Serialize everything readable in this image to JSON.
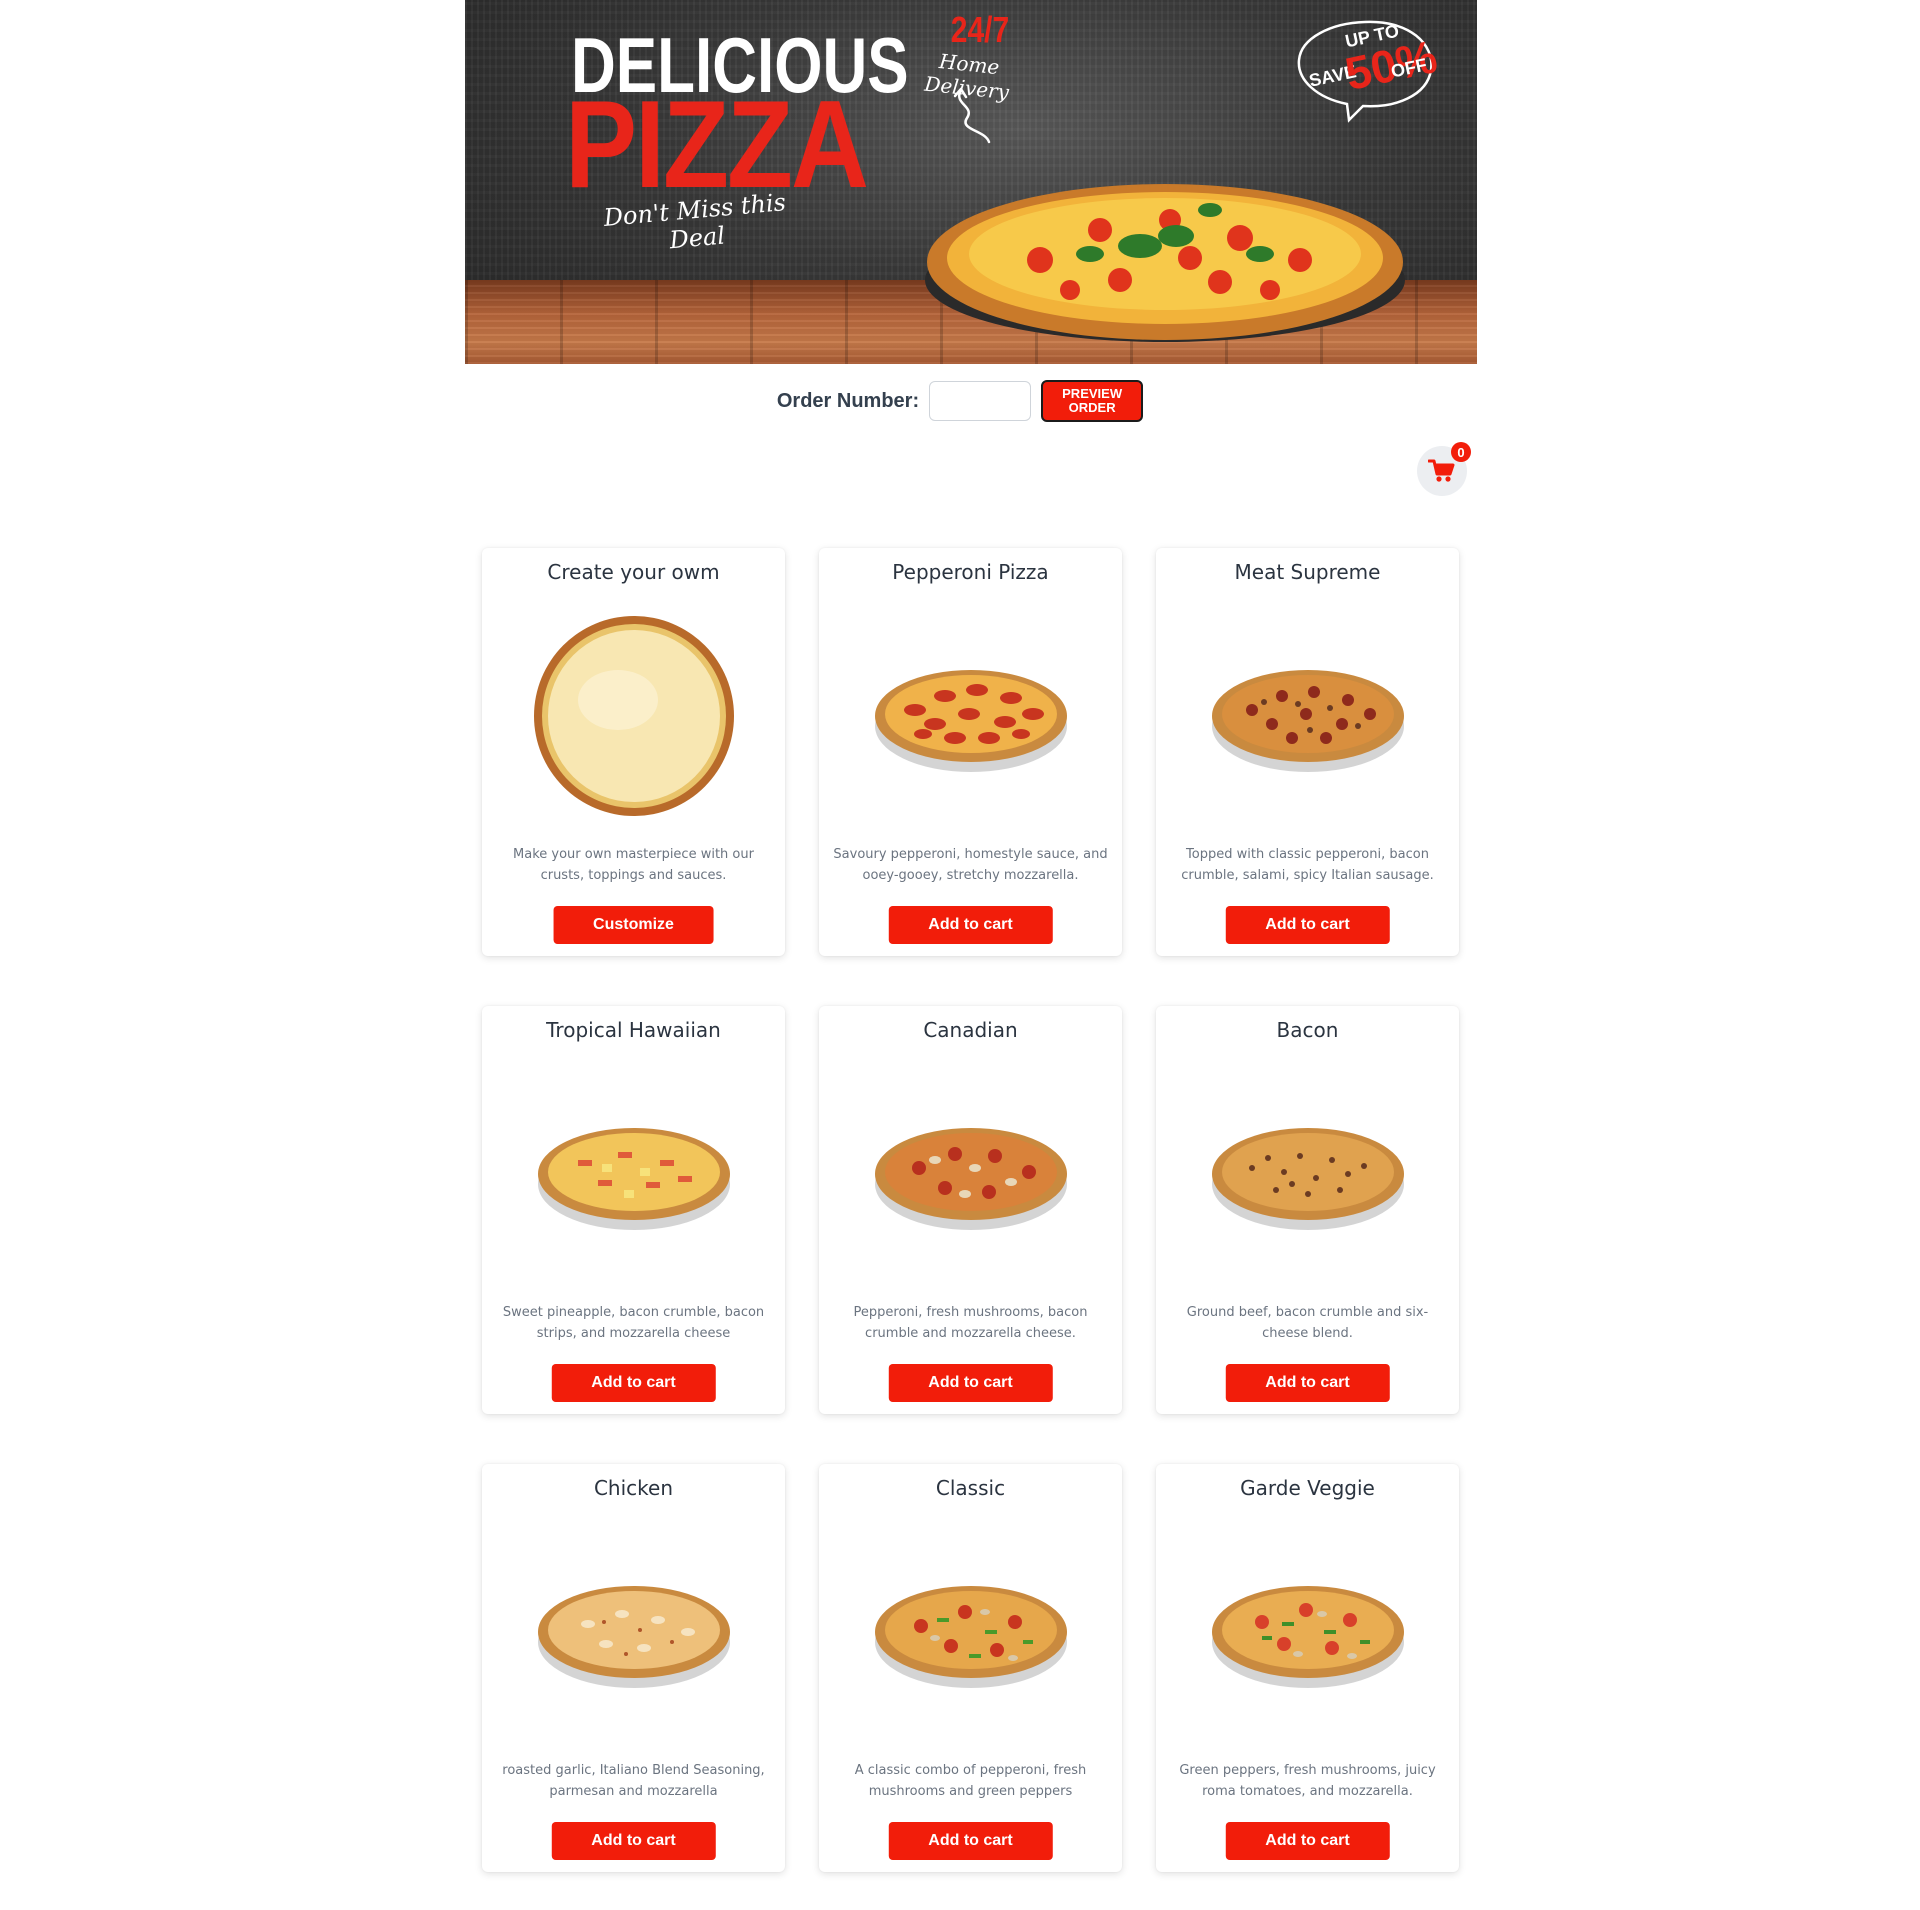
{
  "banner": {
    "headline_top": "DELICIOUS",
    "headline_main": "PIZZA",
    "tagline": "Don't Miss this Deal",
    "delivery_hours": "24/7",
    "delivery_label": "Home Delivery",
    "promo_up_to": "UP TO",
    "promo_save": "SAVE",
    "promo_percent": "50%",
    "promo_off": "OFF",
    "colors": {
      "accent_red": "#e8251a",
      "wall": "#3a3a3a",
      "wood": "#b5643a"
    }
  },
  "order": {
    "label": "Order Number:",
    "input_value": "",
    "input_placeholder": "",
    "preview_button": "PREVIEW ORDER"
  },
  "cart": {
    "icon": "shopping-cart-icon",
    "count": "0"
  },
  "products": [
    {
      "name": "Create your owm",
      "description": "Make your own masterpiece with our crusts, toppings and sauces.",
      "button": "Customize",
      "style": "plain"
    },
    {
      "name": "Pepperoni Pizza",
      "description": "Savoury pepperoni, homestyle sauce, and ooey-gooey, stretchy mozzarella.",
      "button": "Add to cart",
      "style": "pepperoni"
    },
    {
      "name": "Meat Supreme",
      "description": "Topped with classic pepperoni, bacon crumble, salami, spicy Italian sausage.",
      "button": "Add to cart",
      "style": "meat"
    },
    {
      "name": "Tropical Hawaiian",
      "description": "Sweet pineapple, bacon crumble, bacon strips, and mozzarella cheese",
      "button": "Add to cart",
      "style": "hawaiian"
    },
    {
      "name": "Canadian",
      "description": "Pepperoni, fresh mushrooms, bacon crumble and mozzarella cheese.",
      "button": "Add to cart",
      "style": "canadian"
    },
    {
      "name": "Bacon",
      "description": "Ground beef, bacon crumble and six-cheese blend.",
      "button": "Add to cart",
      "style": "bacon"
    },
    {
      "name": "Chicken",
      "description": "roasted garlic, Italiano Blend Seasoning, parmesan and mozzarella",
      "button": "Add to cart",
      "style": "chicken"
    },
    {
      "name": "Classic",
      "description": "A classic combo of pepperoni, fresh mushrooms and green peppers",
      "button": "Add to cart",
      "style": "classic"
    },
    {
      "name": "Garde Veggie",
      "description": "Green peppers, fresh mushrooms, juicy roma tomatoes, and mozzarella.",
      "button": "Add to cart",
      "style": "veggie"
    }
  ],
  "colors": {
    "button_red": "#f21d0a",
    "title_text": "#2b3440",
    "description_text": "#6b7480"
  }
}
